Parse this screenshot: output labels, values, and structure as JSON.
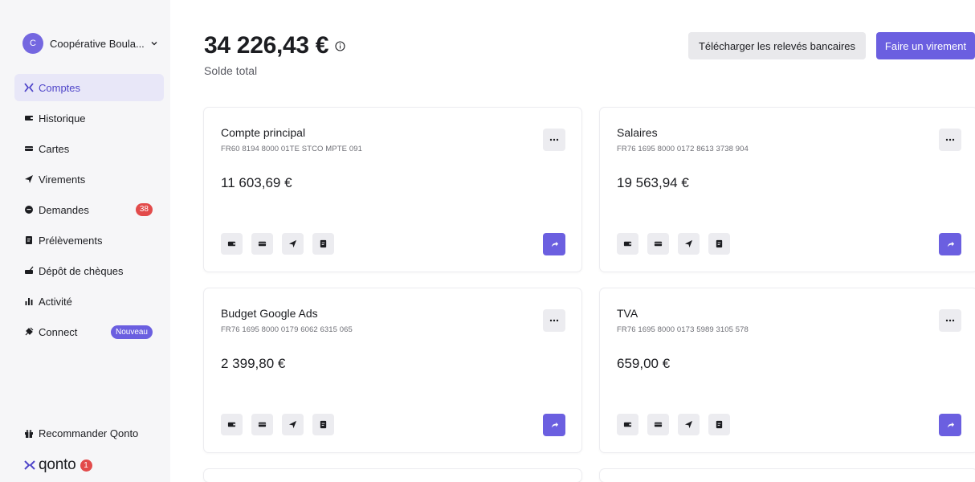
{
  "org": {
    "initial": "C",
    "name": "Coopérative Boula..."
  },
  "nav": [
    {
      "label": "Comptes",
      "icon": "accounts-icon"
    },
    {
      "label": "Historique",
      "icon": "history-icon"
    },
    {
      "label": "Cartes",
      "icon": "card-icon"
    },
    {
      "label": "Virements",
      "icon": "send-icon"
    },
    {
      "label": "Demandes",
      "icon": "chat-icon",
      "badge": "38"
    },
    {
      "label": "Prélèvements",
      "icon": "document-icon"
    },
    {
      "label": "Dépôt de chèques",
      "icon": "check-icon"
    },
    {
      "label": "Activité",
      "icon": "bar-chart-icon"
    },
    {
      "label": "Connect",
      "icon": "plug-icon",
      "badge": "Nouveau"
    }
  ],
  "recommend_label": "Recommander Qonto",
  "logo": {
    "text": "qonto",
    "notification_count": "1"
  },
  "header": {
    "total_amount": "34 226,43 €",
    "total_label": "Solde total",
    "download_label": "Télécharger les relevés bancaires",
    "transfer_label": "Faire un virement"
  },
  "accounts": [
    {
      "name": "Compte principal",
      "iban": "FR60 8194 8000 01TE STCO MPTE 091",
      "balance": "11 603,69 €"
    },
    {
      "name": "Salaires",
      "iban": "FR76 1695 8000 0172 8613 3738 904",
      "balance": "19 563,94 €"
    },
    {
      "name": "Budget Google Ads",
      "iban": "FR76 1695 8000 0179 6062 6315 065",
      "balance": "2 399,80 €"
    },
    {
      "name": "TVA",
      "iban": "FR76 1695 8000 0173 5989 3105 578",
      "balance": "659,00 €"
    }
  ],
  "colors": {
    "accent": "#6b5fe0",
    "active_bg": "#e8e7f8",
    "badge_red": "#e24b4b",
    "sidebar_bg": "#f6f6f8"
  }
}
